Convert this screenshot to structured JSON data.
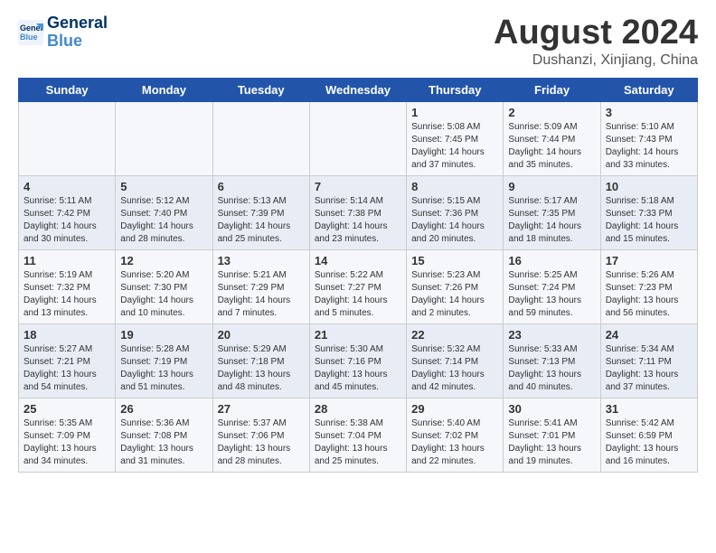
{
  "header": {
    "logo_line1": "General",
    "logo_line2": "Blue",
    "month_title": "August 2024",
    "location": "Dushanzi, Xinjiang, China"
  },
  "weekdays": [
    "Sunday",
    "Monday",
    "Tuesday",
    "Wednesday",
    "Thursday",
    "Friday",
    "Saturday"
  ],
  "weeks": [
    [
      {
        "day": "",
        "info": ""
      },
      {
        "day": "",
        "info": ""
      },
      {
        "day": "",
        "info": ""
      },
      {
        "day": "",
        "info": ""
      },
      {
        "day": "1",
        "info": "Sunrise: 5:08 AM\nSunset: 7:45 PM\nDaylight: 14 hours\nand 37 minutes."
      },
      {
        "day": "2",
        "info": "Sunrise: 5:09 AM\nSunset: 7:44 PM\nDaylight: 14 hours\nand 35 minutes."
      },
      {
        "day": "3",
        "info": "Sunrise: 5:10 AM\nSunset: 7:43 PM\nDaylight: 14 hours\nand 33 minutes."
      }
    ],
    [
      {
        "day": "4",
        "info": "Sunrise: 5:11 AM\nSunset: 7:42 PM\nDaylight: 14 hours\nand 30 minutes."
      },
      {
        "day": "5",
        "info": "Sunrise: 5:12 AM\nSunset: 7:40 PM\nDaylight: 14 hours\nand 28 minutes."
      },
      {
        "day": "6",
        "info": "Sunrise: 5:13 AM\nSunset: 7:39 PM\nDaylight: 14 hours\nand 25 minutes."
      },
      {
        "day": "7",
        "info": "Sunrise: 5:14 AM\nSunset: 7:38 PM\nDaylight: 14 hours\nand 23 minutes."
      },
      {
        "day": "8",
        "info": "Sunrise: 5:15 AM\nSunset: 7:36 PM\nDaylight: 14 hours\nand 20 minutes."
      },
      {
        "day": "9",
        "info": "Sunrise: 5:17 AM\nSunset: 7:35 PM\nDaylight: 14 hours\nand 18 minutes."
      },
      {
        "day": "10",
        "info": "Sunrise: 5:18 AM\nSunset: 7:33 PM\nDaylight: 14 hours\nand 15 minutes."
      }
    ],
    [
      {
        "day": "11",
        "info": "Sunrise: 5:19 AM\nSunset: 7:32 PM\nDaylight: 14 hours\nand 13 minutes."
      },
      {
        "day": "12",
        "info": "Sunrise: 5:20 AM\nSunset: 7:30 PM\nDaylight: 14 hours\nand 10 minutes."
      },
      {
        "day": "13",
        "info": "Sunrise: 5:21 AM\nSunset: 7:29 PM\nDaylight: 14 hours\nand 7 minutes."
      },
      {
        "day": "14",
        "info": "Sunrise: 5:22 AM\nSunset: 7:27 PM\nDaylight: 14 hours\nand 5 minutes."
      },
      {
        "day": "15",
        "info": "Sunrise: 5:23 AM\nSunset: 7:26 PM\nDaylight: 14 hours\nand 2 minutes."
      },
      {
        "day": "16",
        "info": "Sunrise: 5:25 AM\nSunset: 7:24 PM\nDaylight: 13 hours\nand 59 minutes."
      },
      {
        "day": "17",
        "info": "Sunrise: 5:26 AM\nSunset: 7:23 PM\nDaylight: 13 hours\nand 56 minutes."
      }
    ],
    [
      {
        "day": "18",
        "info": "Sunrise: 5:27 AM\nSunset: 7:21 PM\nDaylight: 13 hours\nand 54 minutes."
      },
      {
        "day": "19",
        "info": "Sunrise: 5:28 AM\nSunset: 7:19 PM\nDaylight: 13 hours\nand 51 minutes."
      },
      {
        "day": "20",
        "info": "Sunrise: 5:29 AM\nSunset: 7:18 PM\nDaylight: 13 hours\nand 48 minutes."
      },
      {
        "day": "21",
        "info": "Sunrise: 5:30 AM\nSunset: 7:16 PM\nDaylight: 13 hours\nand 45 minutes."
      },
      {
        "day": "22",
        "info": "Sunrise: 5:32 AM\nSunset: 7:14 PM\nDaylight: 13 hours\nand 42 minutes."
      },
      {
        "day": "23",
        "info": "Sunrise: 5:33 AM\nSunset: 7:13 PM\nDaylight: 13 hours\nand 40 minutes."
      },
      {
        "day": "24",
        "info": "Sunrise: 5:34 AM\nSunset: 7:11 PM\nDaylight: 13 hours\nand 37 minutes."
      }
    ],
    [
      {
        "day": "25",
        "info": "Sunrise: 5:35 AM\nSunset: 7:09 PM\nDaylight: 13 hours\nand 34 minutes."
      },
      {
        "day": "26",
        "info": "Sunrise: 5:36 AM\nSunset: 7:08 PM\nDaylight: 13 hours\nand 31 minutes."
      },
      {
        "day": "27",
        "info": "Sunrise: 5:37 AM\nSunset: 7:06 PM\nDaylight: 13 hours\nand 28 minutes."
      },
      {
        "day": "28",
        "info": "Sunrise: 5:38 AM\nSunset: 7:04 PM\nDaylight: 13 hours\nand 25 minutes."
      },
      {
        "day": "29",
        "info": "Sunrise: 5:40 AM\nSunset: 7:02 PM\nDaylight: 13 hours\nand 22 minutes."
      },
      {
        "day": "30",
        "info": "Sunrise: 5:41 AM\nSunset: 7:01 PM\nDaylight: 13 hours\nand 19 minutes."
      },
      {
        "day": "31",
        "info": "Sunrise: 5:42 AM\nSunset: 6:59 PM\nDaylight: 13 hours\nand 16 minutes."
      }
    ]
  ]
}
